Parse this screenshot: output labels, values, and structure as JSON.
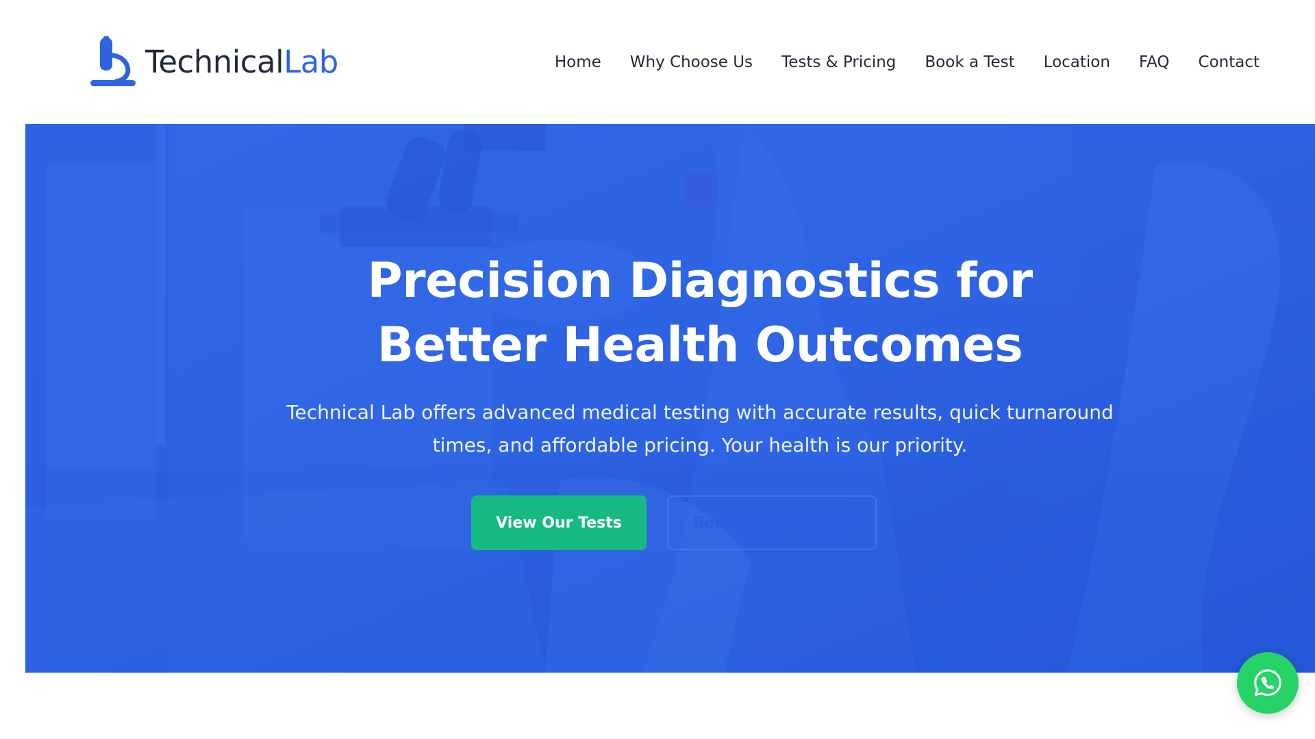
{
  "brand": {
    "name_part1": "Technical",
    "name_part2": "Lab",
    "logo_icon": "microscope-icon",
    "colors": {
      "dark": "#1f2937",
      "accent": "#2f64e0"
    }
  },
  "nav": {
    "items": [
      {
        "label": "Home"
      },
      {
        "label": "Why Choose Us"
      },
      {
        "label": "Tests & Pricing"
      },
      {
        "label": "Book a Test"
      },
      {
        "label": "Location"
      },
      {
        "label": "FAQ"
      },
      {
        "label": "Contact"
      }
    ]
  },
  "hero": {
    "title_line1": "Precision Diagnostics for",
    "title_line2": "Better Health Outcomes",
    "subtitle_line1": "Technical Lab offers advanced medical testing with accurate results, quick turnaround",
    "subtitle_line2": "times, and affordable pricing. Your health is our priority.",
    "primary_button": "View Our Tests",
    "secondary_button": "Book Appointment",
    "colors": {
      "overlay": "#2f63e4",
      "primary_button": "#16b981",
      "text": "#ffffff"
    }
  },
  "floating": {
    "whatsapp_icon": "whatsapp-icon",
    "color": "#25d366"
  }
}
